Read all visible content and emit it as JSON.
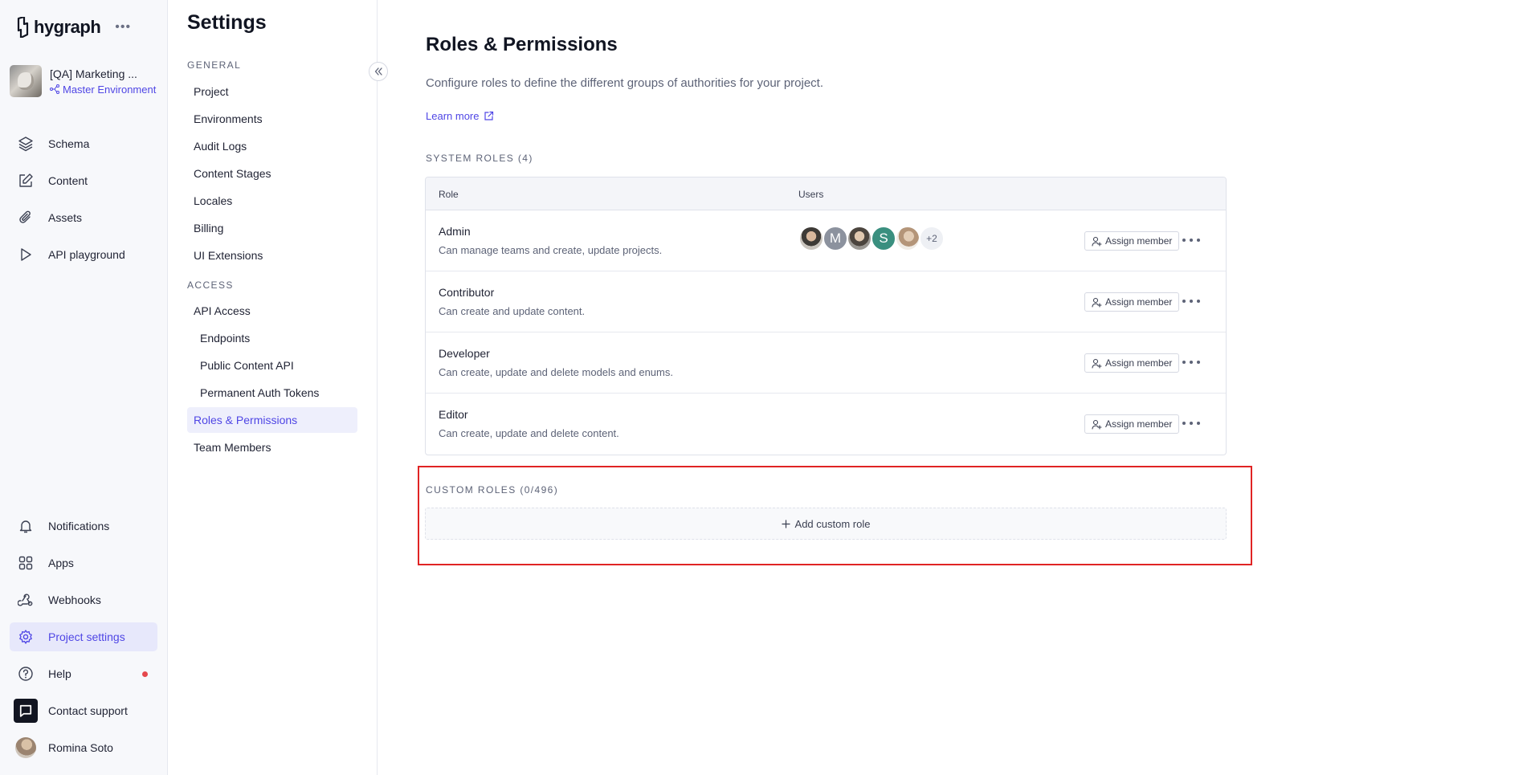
{
  "brand": {
    "name": "hygraph",
    "accent": "#4f46e5"
  },
  "project": {
    "name": "[QA] Marketing ...",
    "environment": "Master Environment"
  },
  "nav": {
    "top": [
      {
        "label": "Schema",
        "icon": "layers-icon"
      },
      {
        "label": "Content",
        "icon": "edit-icon"
      },
      {
        "label": "Assets",
        "icon": "paperclip-icon"
      },
      {
        "label": "API playground",
        "icon": "play-icon"
      }
    ],
    "bottom": [
      {
        "label": "Notifications",
        "icon": "bell-icon"
      },
      {
        "label": "Apps",
        "icon": "apps-grid-icon"
      },
      {
        "label": "Webhooks",
        "icon": "webhook-icon"
      },
      {
        "label": "Project settings",
        "icon": "gear-icon"
      },
      {
        "label": "Help",
        "icon": "help-circle-icon"
      },
      {
        "label": "Contact support",
        "icon": "chat-icon"
      },
      {
        "label": "Romina Soto",
        "icon": "avatar"
      }
    ]
  },
  "settings": {
    "title": "Settings",
    "general_label": "GENERAL",
    "general": [
      "Project",
      "Environments",
      "Audit Logs",
      "Content Stages",
      "Locales",
      "Billing",
      "UI Extensions"
    ],
    "access_label": "ACCESS",
    "access": [
      "API Access",
      "Endpoints",
      "Public Content API",
      "Permanent Auth Tokens",
      "Roles & Permissions",
      "Team Members"
    ]
  },
  "main": {
    "title": "Roles & Permissions",
    "description": "Configure roles to define the different groups of authorities for your project.",
    "learn_more": "Learn more",
    "system_roles_label": "SYSTEM ROLES (4)",
    "table": {
      "col_role": "Role",
      "col_users": "Users",
      "assign_label": "Assign member",
      "rows": [
        {
          "name": "Admin",
          "description": "Can manage teams and create, update projects."
        },
        {
          "name": "Contributor",
          "description": "Can create and update content."
        },
        {
          "name": "Developer",
          "description": "Can create, update and delete models and enums."
        },
        {
          "name": "Editor",
          "description": "Can create, update and delete content."
        }
      ],
      "admin_avatars": [
        "",
        "M",
        "",
        "S",
        ""
      ],
      "admin_more": "+2"
    },
    "custom_roles_label": "CUSTOM ROLES (0/496)",
    "add_custom_role": "Add custom role"
  }
}
